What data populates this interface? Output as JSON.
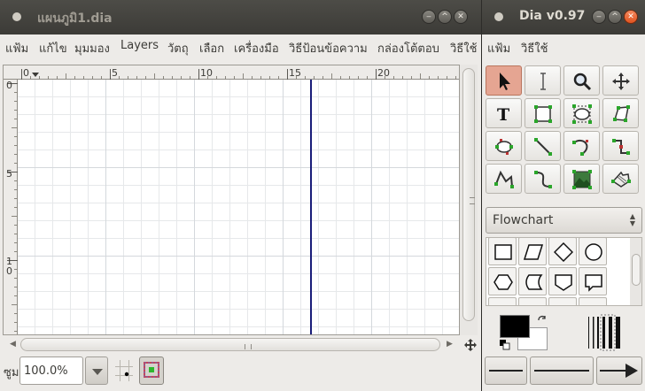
{
  "diagram_window": {
    "title": "แผนภูมิ1.dia",
    "menu": [
      "แฟ้ม",
      "แก้ไข",
      "มุมมอง",
      "Layers",
      "วัตถุ",
      "เลือก",
      "เครื่องมือ",
      "วิธีป้อนข้อความ",
      "กล่องโต้ตอบ",
      "วิธีใช้"
    ],
    "ruler_h": [
      "0",
      "5",
      "10",
      "15",
      "20"
    ],
    "ruler_v": [
      "0",
      "5",
      "10"
    ],
    "zoom_label": "ซูม",
    "zoom_value": "100.0%"
  },
  "toolbox_window": {
    "title": "Dia v0.97",
    "menu": [
      "แฟ้ม",
      "วิธีใช้"
    ],
    "sheet": "Flowchart"
  },
  "colors": {
    "titlebar": "#3c3b37",
    "close_button": "#e0531f",
    "active_tool": "#e5a592",
    "page_break_line": "#1a1d7a",
    "foreground": "#000000",
    "background": "#ffffff"
  },
  "icons": {
    "tools": [
      "pointer-icon",
      "text-cursor-icon",
      "magnify-icon",
      "move-icon",
      "text-icon",
      "box-icon",
      "ellipse-icon",
      "polygon-icon",
      "beziergon-icon",
      "line-icon",
      "arc-icon",
      "zigzag-icon",
      "polyline-icon",
      "bezier-icon",
      "image-icon",
      "outline-icon"
    ],
    "shapes": [
      "rectangle-shape-icon",
      "parallelogram-shape-icon",
      "diamond-shape-icon",
      "ellipse-shape-icon",
      "preparation-shape-icon",
      "stored-data-shape-icon",
      "offpage-shape-icon",
      "document-shape-icon"
    ]
  }
}
